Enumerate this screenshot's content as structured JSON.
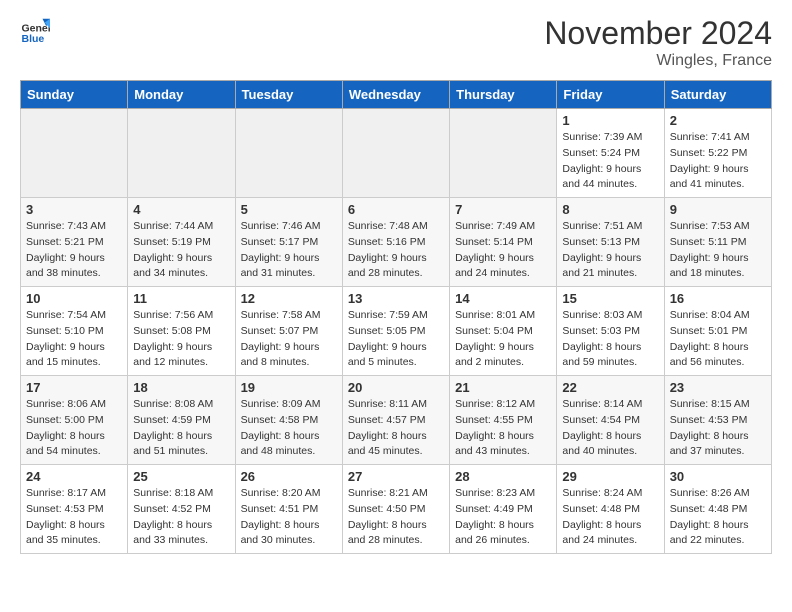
{
  "header": {
    "logo_line1": "General",
    "logo_line2": "Blue",
    "month_title": "November 2024",
    "location": "Wingles, France"
  },
  "days_of_week": [
    "Sunday",
    "Monday",
    "Tuesday",
    "Wednesday",
    "Thursday",
    "Friday",
    "Saturday"
  ],
  "weeks": [
    [
      {
        "day": "",
        "info": ""
      },
      {
        "day": "",
        "info": ""
      },
      {
        "day": "",
        "info": ""
      },
      {
        "day": "",
        "info": ""
      },
      {
        "day": "",
        "info": ""
      },
      {
        "day": "1",
        "info": "Sunrise: 7:39 AM\nSunset: 5:24 PM\nDaylight: 9 hours and 44 minutes."
      },
      {
        "day": "2",
        "info": "Sunrise: 7:41 AM\nSunset: 5:22 PM\nDaylight: 9 hours and 41 minutes."
      }
    ],
    [
      {
        "day": "3",
        "info": "Sunrise: 7:43 AM\nSunset: 5:21 PM\nDaylight: 9 hours and 38 minutes."
      },
      {
        "day": "4",
        "info": "Sunrise: 7:44 AM\nSunset: 5:19 PM\nDaylight: 9 hours and 34 minutes."
      },
      {
        "day": "5",
        "info": "Sunrise: 7:46 AM\nSunset: 5:17 PM\nDaylight: 9 hours and 31 minutes."
      },
      {
        "day": "6",
        "info": "Sunrise: 7:48 AM\nSunset: 5:16 PM\nDaylight: 9 hours and 28 minutes."
      },
      {
        "day": "7",
        "info": "Sunrise: 7:49 AM\nSunset: 5:14 PM\nDaylight: 9 hours and 24 minutes."
      },
      {
        "day": "8",
        "info": "Sunrise: 7:51 AM\nSunset: 5:13 PM\nDaylight: 9 hours and 21 minutes."
      },
      {
        "day": "9",
        "info": "Sunrise: 7:53 AM\nSunset: 5:11 PM\nDaylight: 9 hours and 18 minutes."
      }
    ],
    [
      {
        "day": "10",
        "info": "Sunrise: 7:54 AM\nSunset: 5:10 PM\nDaylight: 9 hours and 15 minutes."
      },
      {
        "day": "11",
        "info": "Sunrise: 7:56 AM\nSunset: 5:08 PM\nDaylight: 9 hours and 12 minutes."
      },
      {
        "day": "12",
        "info": "Sunrise: 7:58 AM\nSunset: 5:07 PM\nDaylight: 9 hours and 8 minutes."
      },
      {
        "day": "13",
        "info": "Sunrise: 7:59 AM\nSunset: 5:05 PM\nDaylight: 9 hours and 5 minutes."
      },
      {
        "day": "14",
        "info": "Sunrise: 8:01 AM\nSunset: 5:04 PM\nDaylight: 9 hours and 2 minutes."
      },
      {
        "day": "15",
        "info": "Sunrise: 8:03 AM\nSunset: 5:03 PM\nDaylight: 8 hours and 59 minutes."
      },
      {
        "day": "16",
        "info": "Sunrise: 8:04 AM\nSunset: 5:01 PM\nDaylight: 8 hours and 56 minutes."
      }
    ],
    [
      {
        "day": "17",
        "info": "Sunrise: 8:06 AM\nSunset: 5:00 PM\nDaylight: 8 hours and 54 minutes."
      },
      {
        "day": "18",
        "info": "Sunrise: 8:08 AM\nSunset: 4:59 PM\nDaylight: 8 hours and 51 minutes."
      },
      {
        "day": "19",
        "info": "Sunrise: 8:09 AM\nSunset: 4:58 PM\nDaylight: 8 hours and 48 minutes."
      },
      {
        "day": "20",
        "info": "Sunrise: 8:11 AM\nSunset: 4:57 PM\nDaylight: 8 hours and 45 minutes."
      },
      {
        "day": "21",
        "info": "Sunrise: 8:12 AM\nSunset: 4:55 PM\nDaylight: 8 hours and 43 minutes."
      },
      {
        "day": "22",
        "info": "Sunrise: 8:14 AM\nSunset: 4:54 PM\nDaylight: 8 hours and 40 minutes."
      },
      {
        "day": "23",
        "info": "Sunrise: 8:15 AM\nSunset: 4:53 PM\nDaylight: 8 hours and 37 minutes."
      }
    ],
    [
      {
        "day": "24",
        "info": "Sunrise: 8:17 AM\nSunset: 4:53 PM\nDaylight: 8 hours and 35 minutes."
      },
      {
        "day": "25",
        "info": "Sunrise: 8:18 AM\nSunset: 4:52 PM\nDaylight: 8 hours and 33 minutes."
      },
      {
        "day": "26",
        "info": "Sunrise: 8:20 AM\nSunset: 4:51 PM\nDaylight: 8 hours and 30 minutes."
      },
      {
        "day": "27",
        "info": "Sunrise: 8:21 AM\nSunset: 4:50 PM\nDaylight: 8 hours and 28 minutes."
      },
      {
        "day": "28",
        "info": "Sunrise: 8:23 AM\nSunset: 4:49 PM\nDaylight: 8 hours and 26 minutes."
      },
      {
        "day": "29",
        "info": "Sunrise: 8:24 AM\nSunset: 4:48 PM\nDaylight: 8 hours and 24 minutes."
      },
      {
        "day": "30",
        "info": "Sunrise: 8:26 AM\nSunset: 4:48 PM\nDaylight: 8 hours and 22 minutes."
      }
    ]
  ]
}
